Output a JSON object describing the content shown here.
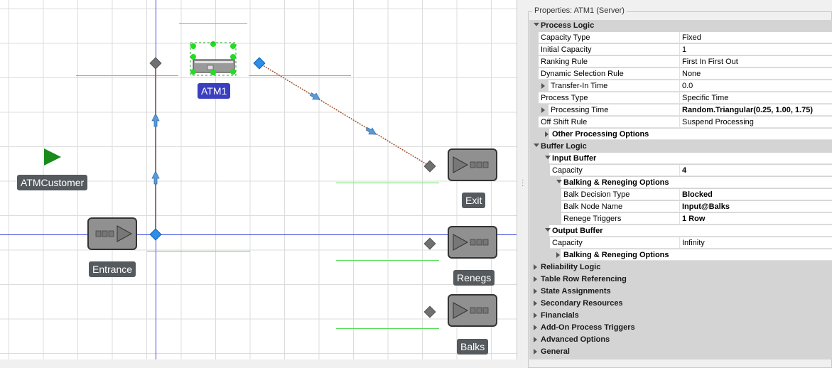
{
  "canvas": {
    "nodes": {
      "atm1": "ATM1",
      "atm_customer": "ATMCustomer",
      "entrance": "Entrance",
      "exit": "Exit",
      "renegs": "Renegs",
      "balks": "Balks"
    }
  },
  "properties": {
    "title": "Properties: ATM1 (Server)",
    "rows": [
      {
        "kind": "cat",
        "name": "Process Logic",
        "expand": "open"
      },
      {
        "kind": "prop",
        "name": "Capacity Type",
        "value": "Fixed"
      },
      {
        "kind": "prop",
        "name": "Initial Capacity",
        "value": "1"
      },
      {
        "kind": "prop",
        "name": "Ranking Rule",
        "value": "First In First Out"
      },
      {
        "kind": "prop",
        "name": "Dynamic Selection Rule",
        "value": "None"
      },
      {
        "kind": "prop",
        "name": "Transfer-In Time",
        "value": "0.0",
        "expand": "closed"
      },
      {
        "kind": "prop",
        "name": "Process Type",
        "value": "Specific Time"
      },
      {
        "kind": "prop",
        "name": "Processing Time",
        "value": "Random.Triangular(0.25, 1.00, 1.75)",
        "expand": "closed",
        "bold_value": true
      },
      {
        "kind": "prop",
        "name": "Off Shift Rule",
        "value": "Suspend Processing"
      },
      {
        "kind": "sub",
        "name": "Other Processing Options",
        "expand": "closed"
      },
      {
        "kind": "cat",
        "name": "Buffer Logic",
        "expand": "open"
      },
      {
        "kind": "sub",
        "name": "Input Buffer",
        "expand": "open"
      },
      {
        "kind": "prop",
        "name": "Capacity",
        "value": "4",
        "indent": 1,
        "bold_value": true
      },
      {
        "kind": "sub",
        "name": "Balking & Reneging Options",
        "expand": "open",
        "indent": 1
      },
      {
        "kind": "prop",
        "name": "Balk Decision Type",
        "value": "Blocked",
        "indent": 2,
        "bold_value": true
      },
      {
        "kind": "prop",
        "name": "Balk Node Name",
        "value": "Input@Balks",
        "indent": 2,
        "bold_value": true
      },
      {
        "kind": "prop",
        "name": "Renege Triggers",
        "value": "1 Row",
        "indent": 2,
        "bold_value": true
      },
      {
        "kind": "sub",
        "name": "Output Buffer",
        "expand": "open"
      },
      {
        "kind": "prop",
        "name": "Capacity",
        "value": "Infinity",
        "indent": 1
      },
      {
        "kind": "sub",
        "name": "Balking & Reneging Options",
        "expand": "closed",
        "indent": 1
      },
      {
        "kind": "cat",
        "name": "Reliability Logic",
        "expand": "closed"
      },
      {
        "kind": "cat",
        "name": "Table Row Referencing",
        "expand": "closed"
      },
      {
        "kind": "cat",
        "name": "State Assignments",
        "expand": "closed"
      },
      {
        "kind": "cat",
        "name": "Secondary Resources",
        "expand": "closed"
      },
      {
        "kind": "cat",
        "name": "Financials",
        "expand": "closed"
      },
      {
        "kind": "cat",
        "name": "Add-On Process Triggers",
        "expand": "closed"
      },
      {
        "kind": "cat",
        "name": "Advanced Options",
        "expand": "closed"
      },
      {
        "kind": "cat",
        "name": "General",
        "expand": "closed"
      }
    ]
  }
}
